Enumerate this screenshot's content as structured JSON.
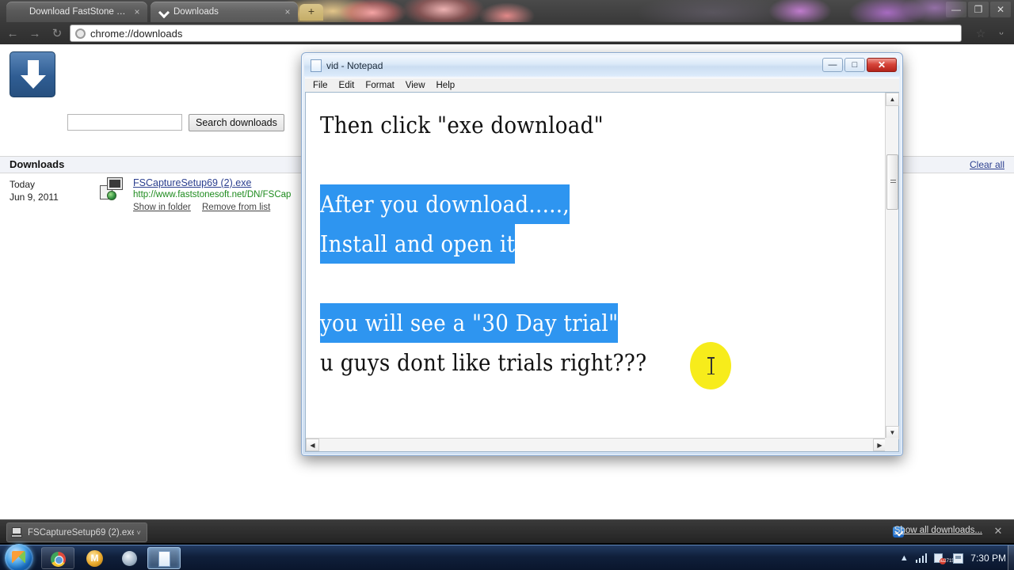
{
  "browser": {
    "tabs": [
      {
        "label": "Download FastStone Cap...",
        "favicon": "faststone-favicon",
        "close": "×"
      },
      {
        "label": "Downloads",
        "favicon": "downloads-favicon",
        "close": "×"
      }
    ],
    "new_tab_label": "+",
    "window_controls": {
      "minimize": "—",
      "maximize": "❐",
      "close": "✕"
    },
    "toolbar": {
      "back": "←",
      "forward": "→",
      "reload": "↻",
      "url": "chrome://downloads",
      "star": "☆",
      "wrench": "ᵕ"
    }
  },
  "downloads_page": {
    "search_placeholder": "",
    "search_value": "",
    "search_button": "Search downloads",
    "section_title": "Downloads",
    "clear_all": "Clear all",
    "items": [
      {
        "date_day": "Today",
        "date_full": "Jun 9, 2011",
        "file_name": "FSCaptureSetup69 (2).exe",
        "url": "http://www.faststonesoft.net/DN/FSCap",
        "show_in_folder": "Show in folder",
        "remove_from_list": "Remove from list"
      }
    ]
  },
  "downloads_shelf": {
    "item_label": "FSCaptureSetup69 (2).exe",
    "item_caret": "˅",
    "show_all": "Show all downloads...",
    "close": "✕"
  },
  "notepad": {
    "title": "vid - Notepad",
    "menu": [
      "File",
      "Edit",
      "Format",
      "View",
      "Help"
    ],
    "controls": {
      "minimize": "—",
      "maximize": "□",
      "close": "✕"
    },
    "lines": [
      {
        "text": "Then click \"exe download\"",
        "selected": false
      },
      {
        "text": "",
        "selected": false
      },
      {
        "text": "After you download.....,",
        "selected": true
      },
      {
        "text": "Install and open it",
        "selected": true
      },
      {
        "text": "",
        "selected": false
      },
      {
        "text": "you will see a \"30 Day trial\"",
        "selected": true
      },
      {
        "text": "u guys dont like trials right???",
        "selected": false
      }
    ],
    "selection_color": "#2e95f0",
    "scroll_up": "▲",
    "scroll_down": "▼",
    "scroll_left": "◀",
    "scroll_right": "▶"
  },
  "cursor": {
    "highlight_color": "#f7ec1b",
    "shape": "i-beam"
  },
  "taskbar": {
    "start": "start-orb",
    "items": [
      {
        "name": "chrome",
        "label": ""
      },
      {
        "name": "messenger",
        "label": "M"
      },
      {
        "name": "misc-app",
        "label": ""
      },
      {
        "name": "notepad",
        "label": ""
      }
    ],
    "tray": {
      "show_hidden": "▲",
      "clock": "7:30 PM"
    }
  }
}
